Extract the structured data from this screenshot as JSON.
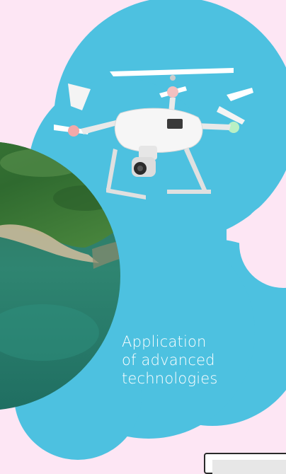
{
  "colors": {
    "background": "#fde6f4",
    "blob": "#4dc1e0",
    "caption_text": "#ffffff"
  },
  "caption": {
    "line1": "Application",
    "line2": "of advanced",
    "line3": "technologies"
  },
  "icons": {
    "drone": "drone-icon",
    "coast_photo": "aerial-coastline-photo"
  }
}
